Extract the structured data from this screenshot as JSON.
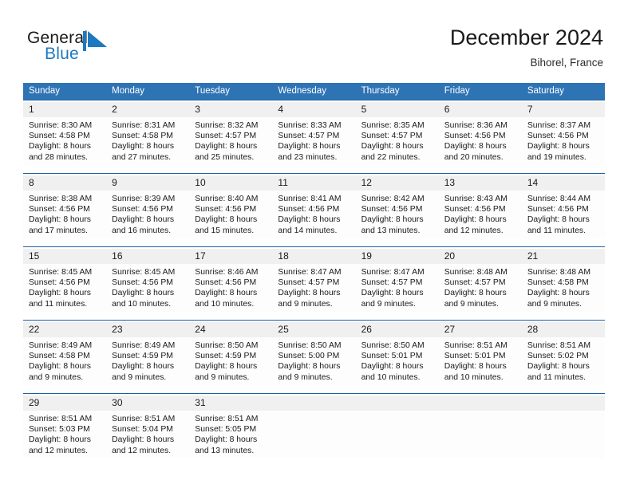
{
  "brand": {
    "name_part1": "General",
    "name_part2": "Blue",
    "logo_icon": "flag-triangle-icon",
    "accent_color": "#1c79c0"
  },
  "header": {
    "title": "December 2024",
    "location": "Bihorel, France"
  },
  "calendar": {
    "header_background": "#2e74b5",
    "daynum_background": "#f0f0f0",
    "separator_color": "#1f5fa0",
    "weekdays": [
      "Sunday",
      "Monday",
      "Tuesday",
      "Wednesday",
      "Thursday",
      "Friday",
      "Saturday"
    ],
    "weeks": [
      [
        {
          "day": "1",
          "sunrise": "Sunrise: 8:30 AM",
          "sunset": "Sunset: 4:58 PM",
          "daylight_line1": "Daylight: 8 hours",
          "daylight_line2": "and 28 minutes."
        },
        {
          "day": "2",
          "sunrise": "Sunrise: 8:31 AM",
          "sunset": "Sunset: 4:58 PM",
          "daylight_line1": "Daylight: 8 hours",
          "daylight_line2": "and 27 minutes."
        },
        {
          "day": "3",
          "sunrise": "Sunrise: 8:32 AM",
          "sunset": "Sunset: 4:57 PM",
          "daylight_line1": "Daylight: 8 hours",
          "daylight_line2": "and 25 minutes."
        },
        {
          "day": "4",
          "sunrise": "Sunrise: 8:33 AM",
          "sunset": "Sunset: 4:57 PM",
          "daylight_line1": "Daylight: 8 hours",
          "daylight_line2": "and 23 minutes."
        },
        {
          "day": "5",
          "sunrise": "Sunrise: 8:35 AM",
          "sunset": "Sunset: 4:57 PM",
          "daylight_line1": "Daylight: 8 hours",
          "daylight_line2": "and 22 minutes."
        },
        {
          "day": "6",
          "sunrise": "Sunrise: 8:36 AM",
          "sunset": "Sunset: 4:56 PM",
          "daylight_line1": "Daylight: 8 hours",
          "daylight_line2": "and 20 minutes."
        },
        {
          "day": "7",
          "sunrise": "Sunrise: 8:37 AM",
          "sunset": "Sunset: 4:56 PM",
          "daylight_line1": "Daylight: 8 hours",
          "daylight_line2": "and 19 minutes."
        }
      ],
      [
        {
          "day": "8",
          "sunrise": "Sunrise: 8:38 AM",
          "sunset": "Sunset: 4:56 PM",
          "daylight_line1": "Daylight: 8 hours",
          "daylight_line2": "and 17 minutes."
        },
        {
          "day": "9",
          "sunrise": "Sunrise: 8:39 AM",
          "sunset": "Sunset: 4:56 PM",
          "daylight_line1": "Daylight: 8 hours",
          "daylight_line2": "and 16 minutes."
        },
        {
          "day": "10",
          "sunrise": "Sunrise: 8:40 AM",
          "sunset": "Sunset: 4:56 PM",
          "daylight_line1": "Daylight: 8 hours",
          "daylight_line2": "and 15 minutes."
        },
        {
          "day": "11",
          "sunrise": "Sunrise: 8:41 AM",
          "sunset": "Sunset: 4:56 PM",
          "daylight_line1": "Daylight: 8 hours",
          "daylight_line2": "and 14 minutes."
        },
        {
          "day": "12",
          "sunrise": "Sunrise: 8:42 AM",
          "sunset": "Sunset: 4:56 PM",
          "daylight_line1": "Daylight: 8 hours",
          "daylight_line2": "and 13 minutes."
        },
        {
          "day": "13",
          "sunrise": "Sunrise: 8:43 AM",
          "sunset": "Sunset: 4:56 PM",
          "daylight_line1": "Daylight: 8 hours",
          "daylight_line2": "and 12 minutes."
        },
        {
          "day": "14",
          "sunrise": "Sunrise: 8:44 AM",
          "sunset": "Sunset: 4:56 PM",
          "daylight_line1": "Daylight: 8 hours",
          "daylight_line2": "and 11 minutes."
        }
      ],
      [
        {
          "day": "15",
          "sunrise": "Sunrise: 8:45 AM",
          "sunset": "Sunset: 4:56 PM",
          "daylight_line1": "Daylight: 8 hours",
          "daylight_line2": "and 11 minutes."
        },
        {
          "day": "16",
          "sunrise": "Sunrise: 8:45 AM",
          "sunset": "Sunset: 4:56 PM",
          "daylight_line1": "Daylight: 8 hours",
          "daylight_line2": "and 10 minutes."
        },
        {
          "day": "17",
          "sunrise": "Sunrise: 8:46 AM",
          "sunset": "Sunset: 4:56 PM",
          "daylight_line1": "Daylight: 8 hours",
          "daylight_line2": "and 10 minutes."
        },
        {
          "day": "18",
          "sunrise": "Sunrise: 8:47 AM",
          "sunset": "Sunset: 4:57 PM",
          "daylight_line1": "Daylight: 8 hours",
          "daylight_line2": "and 9 minutes."
        },
        {
          "day": "19",
          "sunrise": "Sunrise: 8:47 AM",
          "sunset": "Sunset: 4:57 PM",
          "daylight_line1": "Daylight: 8 hours",
          "daylight_line2": "and 9 minutes."
        },
        {
          "day": "20",
          "sunrise": "Sunrise: 8:48 AM",
          "sunset": "Sunset: 4:57 PM",
          "daylight_line1": "Daylight: 8 hours",
          "daylight_line2": "and 9 minutes."
        },
        {
          "day": "21",
          "sunrise": "Sunrise: 8:48 AM",
          "sunset": "Sunset: 4:58 PM",
          "daylight_line1": "Daylight: 8 hours",
          "daylight_line2": "and 9 minutes."
        }
      ],
      [
        {
          "day": "22",
          "sunrise": "Sunrise: 8:49 AM",
          "sunset": "Sunset: 4:58 PM",
          "daylight_line1": "Daylight: 8 hours",
          "daylight_line2": "and 9 minutes."
        },
        {
          "day": "23",
          "sunrise": "Sunrise: 8:49 AM",
          "sunset": "Sunset: 4:59 PM",
          "daylight_line1": "Daylight: 8 hours",
          "daylight_line2": "and 9 minutes."
        },
        {
          "day": "24",
          "sunrise": "Sunrise: 8:50 AM",
          "sunset": "Sunset: 4:59 PM",
          "daylight_line1": "Daylight: 8 hours",
          "daylight_line2": "and 9 minutes."
        },
        {
          "day": "25",
          "sunrise": "Sunrise: 8:50 AM",
          "sunset": "Sunset: 5:00 PM",
          "daylight_line1": "Daylight: 8 hours",
          "daylight_line2": "and 9 minutes."
        },
        {
          "day": "26",
          "sunrise": "Sunrise: 8:50 AM",
          "sunset": "Sunset: 5:01 PM",
          "daylight_line1": "Daylight: 8 hours",
          "daylight_line2": "and 10 minutes."
        },
        {
          "day": "27",
          "sunrise": "Sunrise: 8:51 AM",
          "sunset": "Sunset: 5:01 PM",
          "daylight_line1": "Daylight: 8 hours",
          "daylight_line2": "and 10 minutes."
        },
        {
          "day": "28",
          "sunrise": "Sunrise: 8:51 AM",
          "sunset": "Sunset: 5:02 PM",
          "daylight_line1": "Daylight: 8 hours",
          "daylight_line2": "and 11 minutes."
        }
      ],
      [
        {
          "day": "29",
          "sunrise": "Sunrise: 8:51 AM",
          "sunset": "Sunset: 5:03 PM",
          "daylight_line1": "Daylight: 8 hours",
          "daylight_line2": "and 12 minutes."
        },
        {
          "day": "30",
          "sunrise": "Sunrise: 8:51 AM",
          "sunset": "Sunset: 5:04 PM",
          "daylight_line1": "Daylight: 8 hours",
          "daylight_line2": "and 12 minutes."
        },
        {
          "day": "31",
          "sunrise": "Sunrise: 8:51 AM",
          "sunset": "Sunset: 5:05 PM",
          "daylight_line1": "Daylight: 8 hours",
          "daylight_line2": "and 13 minutes."
        },
        {
          "day": "",
          "sunrise": "",
          "sunset": "",
          "daylight_line1": "",
          "daylight_line2": ""
        },
        {
          "day": "",
          "sunrise": "",
          "sunset": "",
          "daylight_line1": "",
          "daylight_line2": ""
        },
        {
          "day": "",
          "sunrise": "",
          "sunset": "",
          "daylight_line1": "",
          "daylight_line2": ""
        },
        {
          "day": "",
          "sunrise": "",
          "sunset": "",
          "daylight_line1": "",
          "daylight_line2": ""
        }
      ]
    ]
  }
}
